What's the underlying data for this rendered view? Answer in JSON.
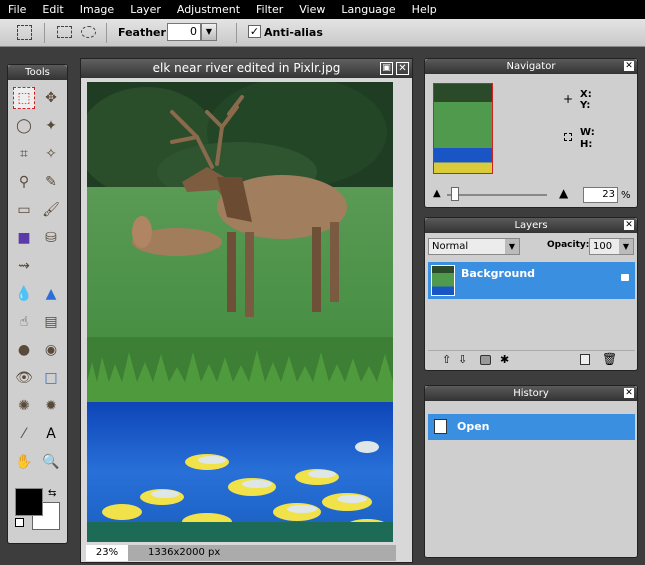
{
  "menu": [
    "File",
    "Edit",
    "Image",
    "Layer",
    "Adjustment",
    "Filter",
    "View",
    "Language",
    "Help"
  ],
  "options": {
    "feather_label": "Feather:",
    "feather_value": "0",
    "antialias_label": "Anti-alias"
  },
  "tools_title": "Tools",
  "tools": [
    "marquee-icon",
    "move-icon",
    "lasso-icon",
    "wand-icon",
    "crop-icon",
    "magic-wand-icon",
    "stamp-icon",
    "pencil-icon",
    "eraser-icon",
    "brush-icon",
    "rect-fill-icon",
    "bucket-icon",
    "color-replace-icon",
    "",
    "drop-icon",
    "sharpen-icon",
    "smudge-icon",
    "sponge-icon",
    "burn-icon",
    "redeye-icon",
    "eye-icon",
    "shape-icon",
    "bloat-icon",
    "pinch-icon",
    "eyedropper-icon",
    "text-icon",
    "hand-icon",
    "zoom-icon"
  ],
  "document": {
    "title": "elk near river edited in Pixlr.jpg",
    "zoom": "23%",
    "size": "1336x2000 px"
  },
  "navigator": {
    "title": "Navigator",
    "x_label": "X:",
    "y_label": "Y:",
    "w_label": "W:",
    "h_label": "H:",
    "zoom_value": "23",
    "zoom_unit": "%"
  },
  "layers": {
    "title": "Layers",
    "blend_mode": "Normal",
    "opacity_label": "Opacity:",
    "opacity_value": "100",
    "layer_name": "Background"
  },
  "history": {
    "title": "History",
    "items": [
      "Open"
    ]
  },
  "colors": {
    "accent": "#3b8fe0",
    "primary": "#000000",
    "secondary": "#ffffff"
  }
}
